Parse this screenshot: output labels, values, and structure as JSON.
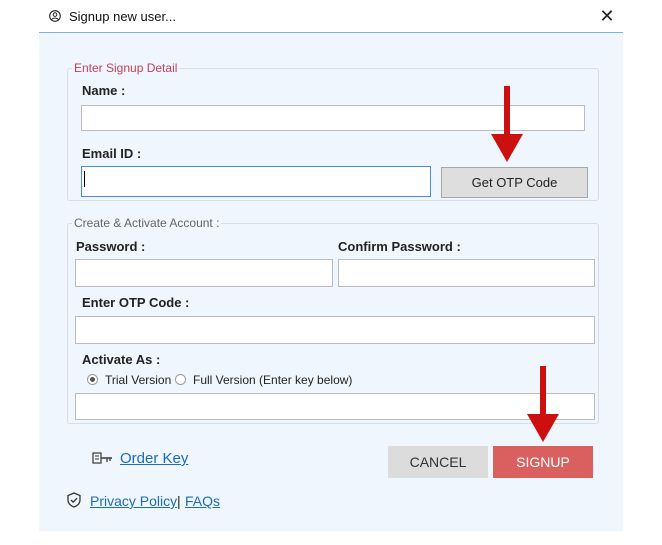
{
  "window": {
    "title": "Signup new user...",
    "close_glyph": "✕",
    "icon": "user-circle-icon"
  },
  "signup_group": {
    "legend": "Enter Signup Detail",
    "name_label": "Name :",
    "name_value": "",
    "email_label": "Email ID :",
    "email_value": "",
    "otp_button": "Get OTP Code"
  },
  "activate_group": {
    "legend": "Create & Activate Account :",
    "password_label": "Password :",
    "confirm_label": "Confirm Password :",
    "otp_label": "Enter OTP Code :",
    "activate_label": "Activate As :",
    "trial_label": "Trial Version",
    "full_label": "Full Version (Enter key below)",
    "selected": "trial",
    "key_value": ""
  },
  "footer": {
    "order_key": "Order Key",
    "privacy": "Privacy Policy",
    "separator": "|",
    "faqs": "FAQs",
    "cancel": "CANCEL",
    "signup": "SIGNUP"
  },
  "colors": {
    "accent_legend": "#c2405a",
    "signup_button": "#d9605f",
    "cancel_button": "#dcdcdc",
    "arrow": "#cc1010",
    "link": "#1a6bb8"
  }
}
